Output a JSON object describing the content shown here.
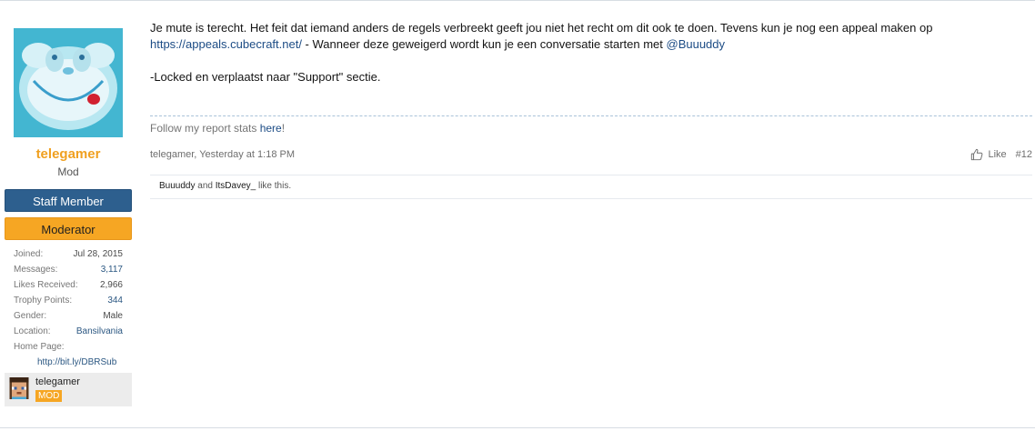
{
  "user": {
    "name": "telegamer",
    "title": "Mod",
    "banners": {
      "staff": "Staff Member",
      "moderator": "Moderator"
    },
    "stats": [
      {
        "label": "Joined:",
        "value": "Jul 28, 2015"
      },
      {
        "label": "Messages:",
        "value": "3,117"
      },
      {
        "label": "Likes Received:",
        "value": "2,966"
      },
      {
        "label": "Trophy Points:",
        "value": "344"
      },
      {
        "label": "Gender:",
        "value": "Male"
      },
      {
        "label": "Location:",
        "value": "Bansilvania"
      }
    ],
    "homepage": {
      "label": "Home Page:",
      "url_text": "http://bit.ly/DBRSub"
    },
    "minecraft": {
      "name": "telegamer",
      "rank": "MOD"
    }
  },
  "post": {
    "line1": "Je mute is terecht. Het feit dat iemand anders de regels verbreekt geeft jou niet het recht om dit ook te doen. Tevens kun je nog een appeal maken op",
    "appeal_link": "https://appeals.cubecraft.net/",
    "line2_mid": " - Wanneer deze geweigerd wordt kun je een conversatie starten met ",
    "mention": "@Buuuddy",
    "line3": "-Locked en verplaatst naar \"Support\" sectie."
  },
  "signature": {
    "prefix": "Follow my report stats ",
    "link": "here",
    "suffix": "!"
  },
  "meta": {
    "author_time": "telegamer, Yesterday at 1:18 PM",
    "like_label": "Like",
    "post_number": "#12"
  },
  "likes": {
    "user1": "Buuuddy",
    "and": " and ",
    "user2": "ItsDavey_",
    "suffix": " like this."
  },
  "colors": {
    "username": "#f0a020",
    "staff_banner": "#2d5f8e",
    "moderator_banner": "#f6a623",
    "link": "#1c4c85"
  }
}
